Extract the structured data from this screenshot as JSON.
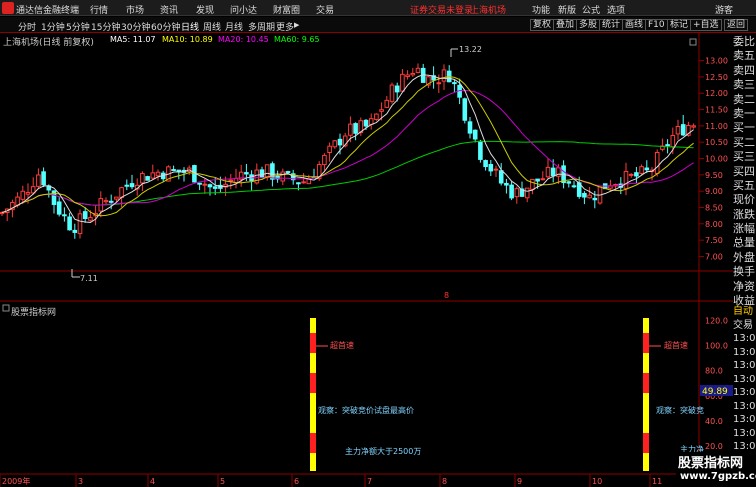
{
  "window": {
    "title": "通达信金融终端",
    "menus": [
      "行情",
      "市场",
      "资讯",
      "发现",
      "问小达",
      "财富圈",
      "交易"
    ],
    "status": "证券交易未登录",
    "exchange": "上海机场",
    "right_menus": [
      "功能",
      "新版",
      "公式",
      "选项"
    ],
    "guest": "游客"
  },
  "toolbar": {
    "periods": [
      "分时",
      "1分钟",
      "5分钟",
      "15分钟",
      "30分钟",
      "60分钟",
      "日线",
      "周线",
      "月线",
      "多周期",
      "更多"
    ],
    "active_period": "日线",
    "more_arrow": "▶",
    "buttons": [
      "复权",
      "叠加",
      "多股",
      "统计",
      "画线",
      "F10",
      "标记",
      "+自选",
      "返回"
    ]
  },
  "main": {
    "stock_label": "上海机场(日线 前复权)",
    "ma": [
      {
        "label": "MA5: 11.07",
        "color": "#ffffff"
      },
      {
        "label": "MA10: 10.89",
        "color": "#ffff00"
      },
      {
        "label": "MA20: 10.45",
        "color": "#ff00ff"
      },
      {
        "label": "MA60: 9.65",
        "color": "#00ff00"
      }
    ],
    "price_axis": [
      "13.00",
      "12.50",
      "12.00",
      "11.50",
      "11.00",
      "10.50",
      "10.00",
      "9.50",
      "9.00",
      "8.50",
      "8.00",
      "7.50",
      "7.00"
    ],
    "high_label": "13.22",
    "low_label": "7.11",
    "marker": "8"
  },
  "orderbook": [
    "委比",
    "卖五",
    "卖四",
    "卖三",
    "卖二",
    "卖一",
    "买一",
    "买二",
    "买三",
    "买四",
    "买五",
    "现价",
    "涨跌",
    "涨幅",
    "总量",
    "外盘",
    "换手",
    "净资",
    "收益"
  ],
  "sub": {
    "title": "股票指标网",
    "axis": [
      "120.0",
      "100.0",
      "80.0",
      "60.0",
      "40.0",
      "20.0",
      "0.0"
    ],
    "value_badge": "49.89",
    "right_header": [
      "自动",
      "交易"
    ],
    "times": [
      "13:02",
      "13:02",
      "13:02",
      "13:02",
      "13:02",
      "13:02",
      "13:03",
      "13:03",
      "13:03",
      "13:03",
      "13:03",
      "13:03",
      "13:03"
    ],
    "annotations": {
      "buy_label": "超首速",
      "watch_label": "观察：突破竞价试盘最高价",
      "watch_label_short": "观察：突破竞",
      "net_label": "主力净额大于2500万",
      "net_label_short": "主力净"
    }
  },
  "date_axis": [
    "2009年",
    "3",
    "4",
    "5",
    "6",
    "7",
    "8",
    "9",
    "10",
    "11"
  ],
  "watermark": {
    "line1": "股票指标网",
    "line2": "www.7gpzb.com"
  },
  "chart_data": {
    "type": "candlestick",
    "title": "上海机场(日线 前复权)",
    "ylim": [
      6.8,
      13.6
    ],
    "high": 13.22,
    "low": 7.11,
    "ma_last": {
      "MA5": 11.07,
      "MA10": 10.89,
      "MA20": 10.45,
      "MA60": 9.65
    },
    "months": [
      "3",
      "4",
      "5",
      "6",
      "7",
      "8",
      "9",
      "10",
      "11"
    ],
    "indicator": {
      "ylim": [
        0,
        130
      ],
      "ticks": [
        120,
        100,
        80,
        60,
        40,
        20,
        0
      ],
      "current": 49.89
    }
  }
}
